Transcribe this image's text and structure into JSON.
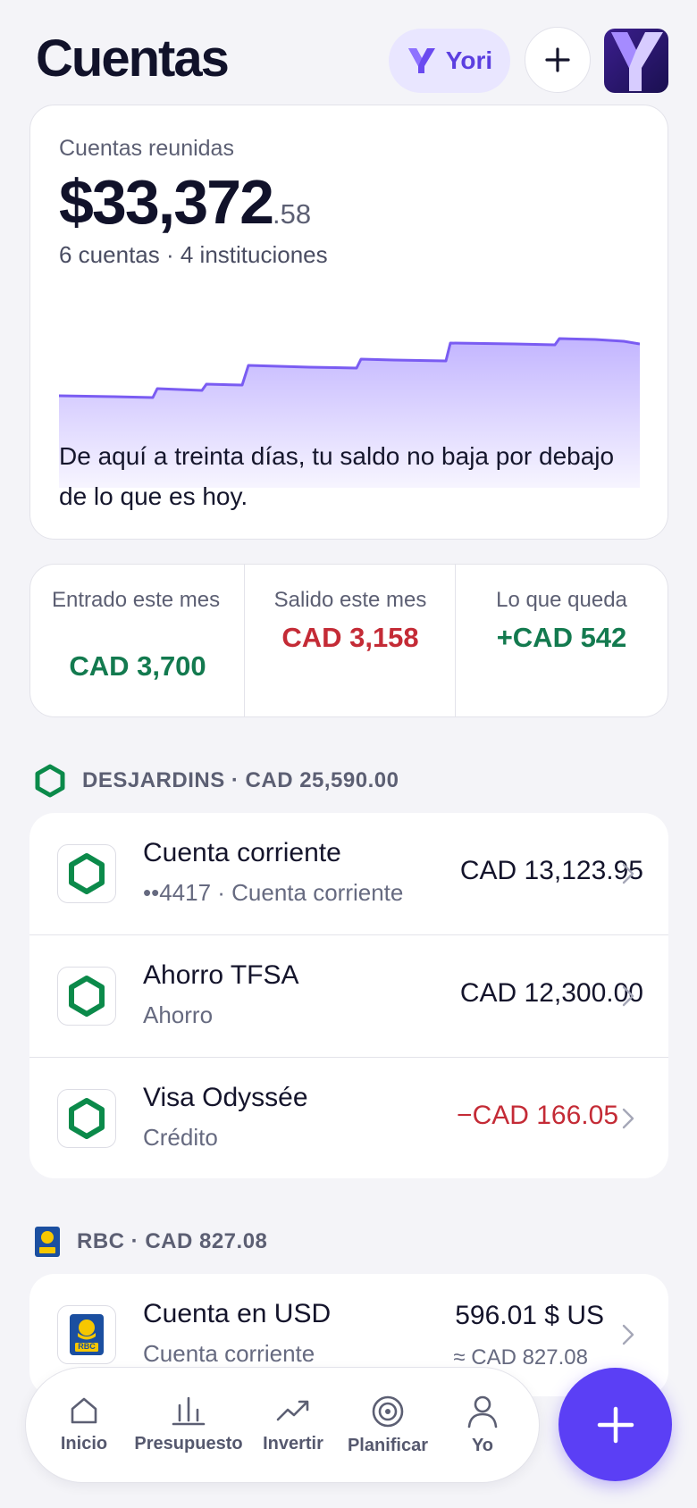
{
  "header": {
    "title": "Cuentas",
    "assistant_label": "Yori"
  },
  "summary": {
    "label": "Cuentas reunidas",
    "amount_main": "$33,372",
    "amount_cents": ".58",
    "subtitle": "6 cuentas · 4 instituciones",
    "forecast_note": "De aquí a treinta días, tu saldo no baja por debajo de lo que es hoy."
  },
  "flow": {
    "in_label": "Entrado este mes",
    "in_value": "CAD 3,700",
    "out_label": "Salido este mes",
    "out_value": "CAD 3,158",
    "left_label": "Lo que queda",
    "left_value": "+CAD 542"
  },
  "institutions": [
    {
      "header": "DESJARDINS · CAD 25,590.00",
      "accounts": [
        {
          "name": "Cuenta corriente",
          "meta": "••4417 · Cuenta corriente",
          "balance": "CAD 13,123.95"
        },
        {
          "name": "Ahorro TFSA",
          "meta": "Ahorro",
          "balance": "CAD 12,300.00"
        },
        {
          "name": "Visa Odyssée",
          "meta": "Crédito",
          "balance": "−CAD 166.05"
        }
      ]
    },
    {
      "header": "RBC · CAD 827.08",
      "accounts": [
        {
          "name": "Cuenta en USD",
          "meta": "Cuenta corriente",
          "balance": "596.01 $ US",
          "balance_sub": "≈ CAD 827.08",
          "logo_text": "RBC"
        }
      ]
    }
  ],
  "nav": {
    "items": [
      "Inicio",
      "Presupuesto",
      "Invertir",
      "Planificar",
      "Yo"
    ]
  },
  "colors": {
    "accent": "#5B3FF5",
    "positive": "#137A4F",
    "negative": "#C42B36",
    "desjardins": "#0B8A4A",
    "rbc_blue": "#1B4FA0",
    "rbc_gold": "#F6C700"
  },
  "icons": [
    "yori-logo-icon",
    "plus-icon",
    "app-logo-icon",
    "desjardins-hexagon-icon",
    "rbc-lion-icon",
    "chevron-right-icon",
    "home-icon",
    "bar-chart-icon",
    "trend-up-icon",
    "target-icon",
    "person-icon"
  ]
}
